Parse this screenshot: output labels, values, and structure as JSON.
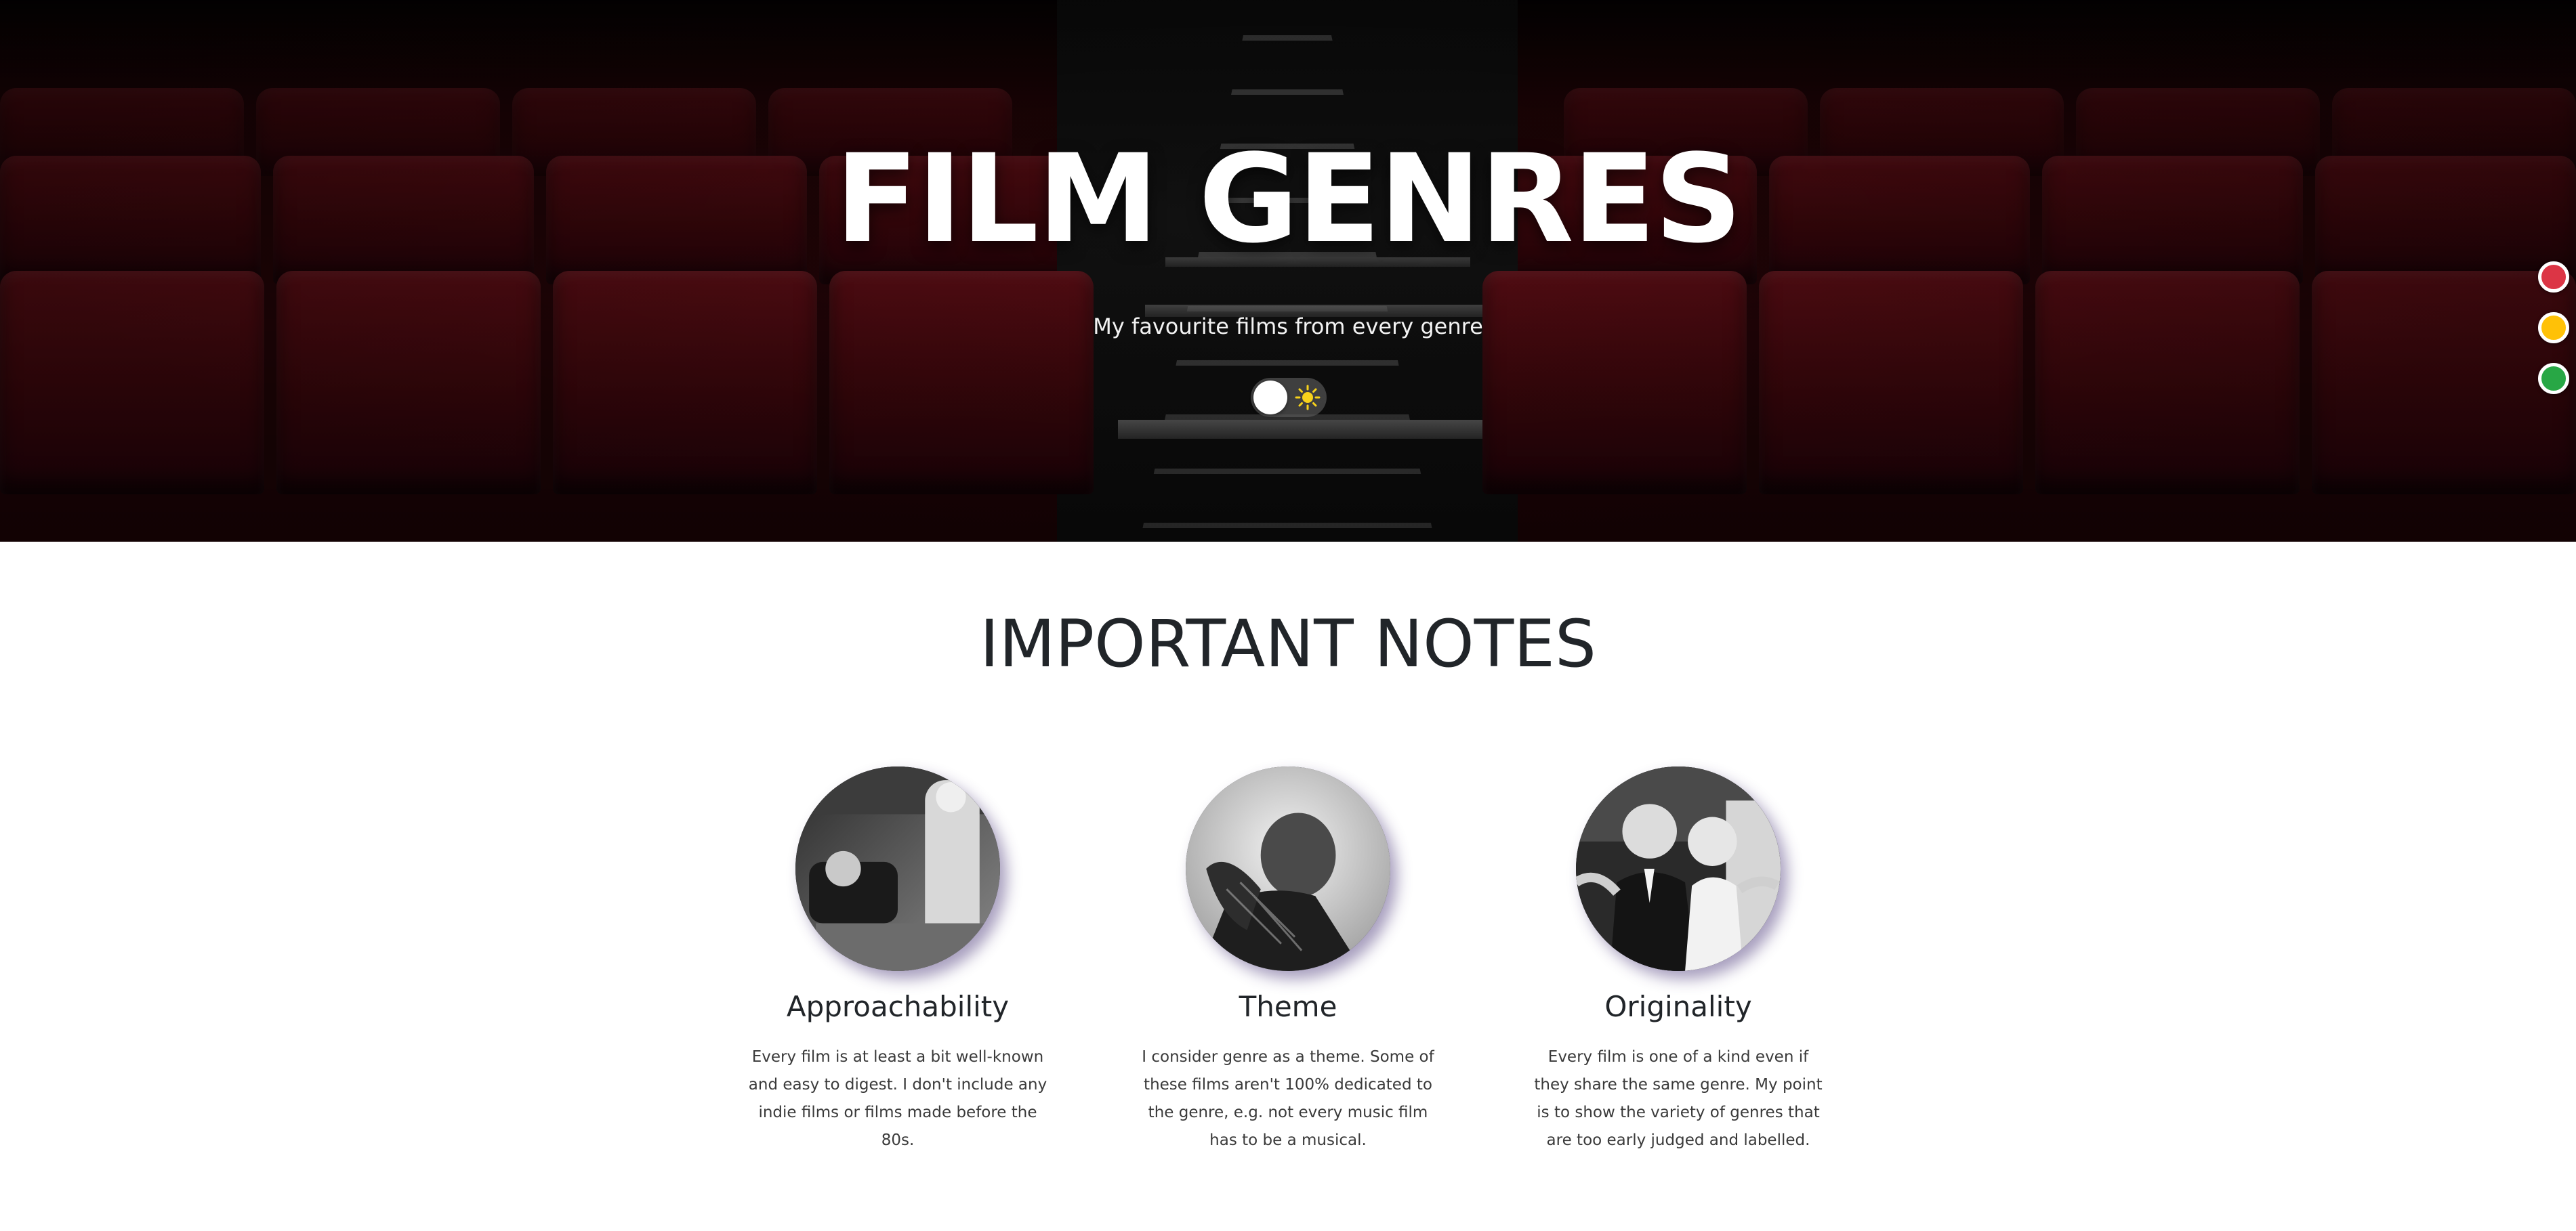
{
  "hero": {
    "title": "FILM GENRES",
    "subtitle": "My favourite films from every genre",
    "theme_toggle": {
      "state": "light",
      "icon": "sun-icon"
    }
  },
  "color_switcher": {
    "colors": [
      "#dc3545",
      "#ffc107",
      "#28a745"
    ]
  },
  "notes": {
    "title": "IMPORTANT NOTES",
    "cards": [
      {
        "title": "Approachability",
        "text": "Every film is at least a bit well-known and easy to digest. I don't include any indie films or films made before the 80s."
      },
      {
        "title": "Theme",
        "text": "I consider genre as a theme. Some of these films aren't 100% dedicated to the genre, e.g. not every music film has to be a musical."
      },
      {
        "title": "Originality",
        "text": "Every film is one of a kind even if they share the same genre. My point is to show the variety of genres that are too early judged and labelled."
      }
    ]
  }
}
